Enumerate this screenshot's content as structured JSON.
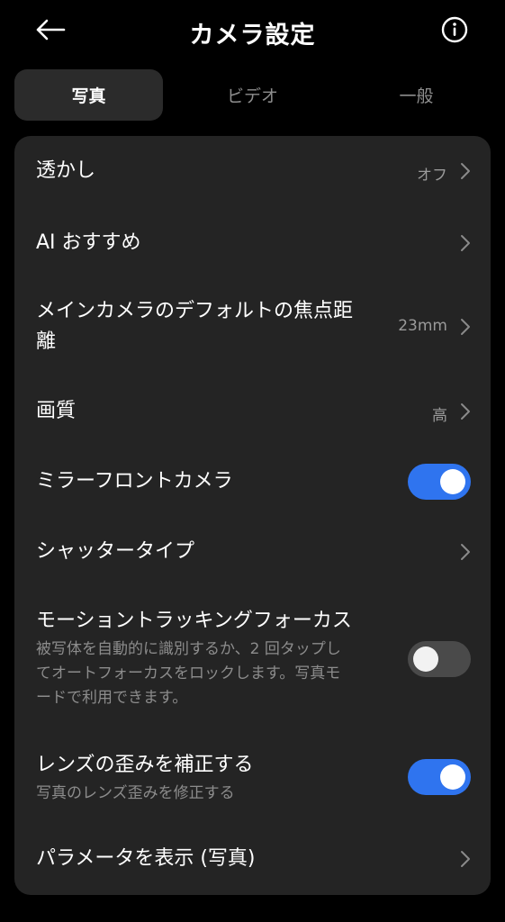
{
  "header": {
    "title": "カメラ設定"
  },
  "tabs": [
    {
      "label": "写真",
      "active": true
    },
    {
      "label": "ビデオ",
      "active": false
    },
    {
      "label": "一般",
      "active": false
    }
  ],
  "settings": [
    {
      "title": "透かし",
      "value": "オフ",
      "control": "chevron"
    },
    {
      "title": "AI おすすめ",
      "value": "",
      "control": "chevron"
    },
    {
      "title_line1": "メインカメラのデフォルトの焦点距",
      "title_line2": "離",
      "value": "23mm",
      "control": "chevron"
    },
    {
      "title": "画質",
      "value": "高",
      "control": "chevron"
    },
    {
      "title": "ミラーフロントカメラ",
      "control": "toggle",
      "enabled": true
    },
    {
      "title": "シャッタータイプ",
      "value": "",
      "control": "chevron"
    },
    {
      "title": "モーショントラッキングフォーカス",
      "desc_line1": "被写体を自動的に識別するか、2 回タップし",
      "desc_line2": "てオートフォーカスをロックします。写真モ",
      "desc_line3": "ードで利用できます。",
      "control": "toggle",
      "enabled": false
    },
    {
      "title": "レンズの歪みを補正する",
      "desc": "写真のレンズ歪みを修正する",
      "control": "toggle",
      "enabled": true
    },
    {
      "title": "パラメータを表示 (写真)",
      "value": "",
      "control": "chevron"
    }
  ],
  "icons": {
    "back": "arrow-left-icon",
    "info": "info-icon",
    "chevron": "chevron-right-icon"
  },
  "colors": {
    "background": "#000000",
    "card": "#242424",
    "active_tab": "#2b2b2b",
    "accent": "#2f74ef"
  }
}
